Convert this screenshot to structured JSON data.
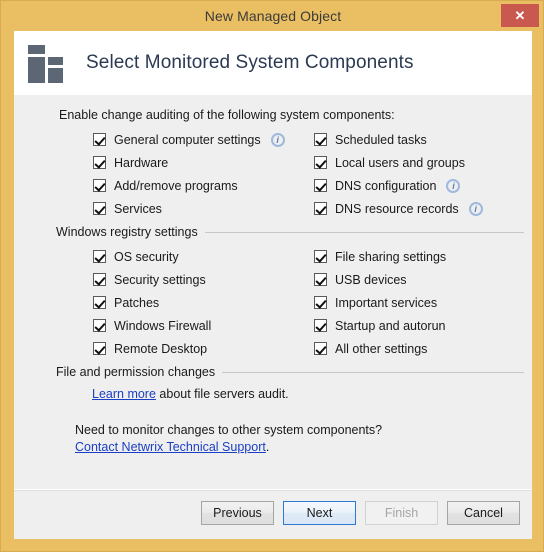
{
  "window": {
    "title": "New Managed Object",
    "close_label": "✕"
  },
  "header": {
    "title": "Select Monitored System Components",
    "icon": "system-components-icon"
  },
  "content": {
    "intro": "Enable change auditing of the following system components:",
    "system_components": {
      "left": [
        {
          "label": "General computer settings",
          "checked": true,
          "info": true
        },
        {
          "label": "Hardware",
          "checked": true,
          "info": false
        },
        {
          "label": "Add/remove programs",
          "checked": true,
          "info": false
        },
        {
          "label": "Services",
          "checked": true,
          "info": false
        }
      ],
      "right": [
        {
          "label": "Scheduled tasks",
          "checked": true,
          "info": false
        },
        {
          "label": "Local users and groups",
          "checked": true,
          "info": false
        },
        {
          "label": "DNS configuration",
          "checked": true,
          "info": true
        },
        {
          "label": "DNS resource records",
          "checked": true,
          "info": true
        }
      ]
    },
    "registry_group": {
      "title": "Windows registry settings",
      "left": [
        {
          "label": "OS security",
          "checked": true,
          "info": false
        },
        {
          "label": "Security settings",
          "checked": true,
          "info": false
        },
        {
          "label": "Patches",
          "checked": true,
          "info": false
        },
        {
          "label": "Windows Firewall",
          "checked": true,
          "info": false
        },
        {
          "label": "Remote Desktop",
          "checked": true,
          "info": false
        }
      ],
      "right": [
        {
          "label": "File sharing settings",
          "checked": true,
          "info": false
        },
        {
          "label": "USB devices",
          "checked": true,
          "info": false
        },
        {
          "label": "Important services",
          "checked": true,
          "info": false
        },
        {
          "label": "Startup and autorun",
          "checked": true,
          "info": false
        },
        {
          "label": "All other settings",
          "checked": true,
          "info": false
        }
      ]
    },
    "file_group": {
      "title": "File and permission changes",
      "learn_more_link": "Learn more",
      "learn_more_rest": " about file servers audit."
    },
    "support": {
      "question": "Need to monitor changes to other system components?",
      "link": "Contact Netwrix Technical Support",
      "period": "."
    },
    "info_glyph": "i"
  },
  "footer": {
    "buttons": [
      {
        "label": "Previous",
        "state": "normal"
      },
      {
        "label": "Next",
        "state": "default"
      },
      {
        "label": "Finish",
        "state": "disabled"
      },
      {
        "label": "Cancel",
        "state": "normal"
      }
    ]
  },
  "colors": {
    "title_bar": "#eabf63",
    "close_button": "#c9584f",
    "icon_gray": "#5d6675",
    "header_title": "#2b3a52",
    "link": "#1b3fc4",
    "info_ring": "#9fb8dd",
    "focus_border": "#2b7ad1"
  }
}
